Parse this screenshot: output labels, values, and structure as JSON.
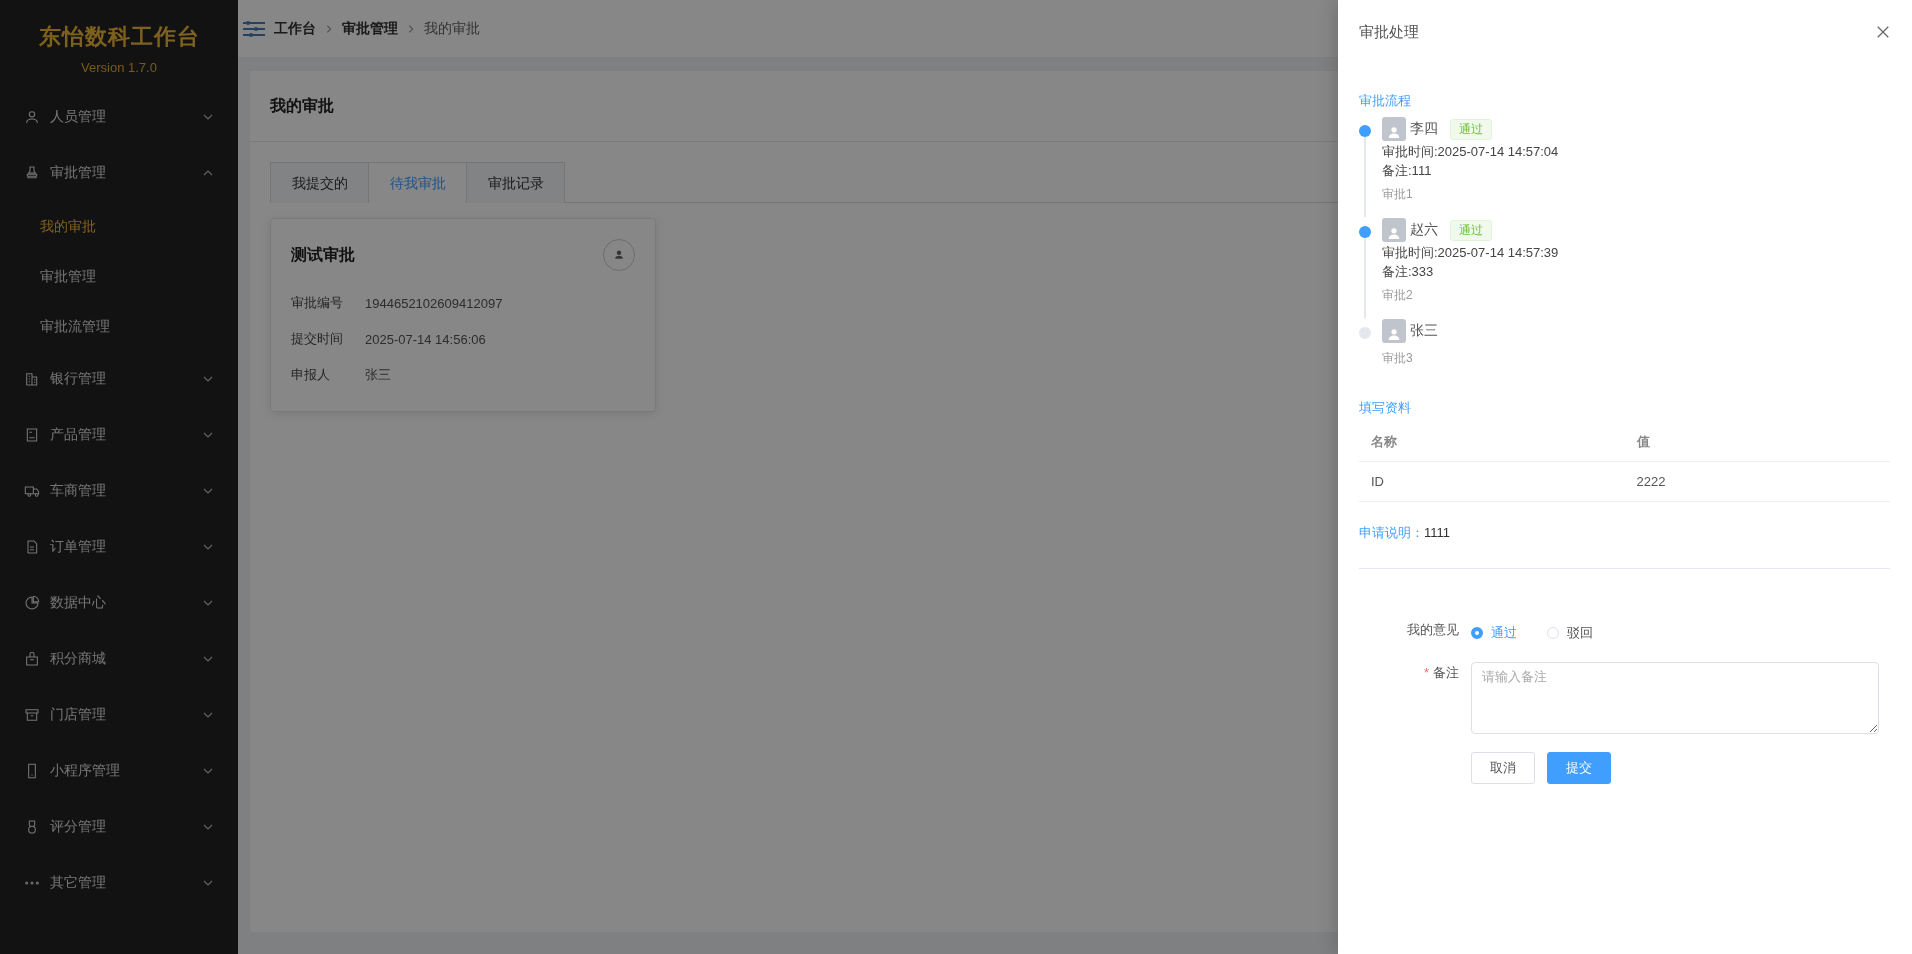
{
  "sidebar": {
    "title": "东怡数科工作台",
    "version": "Version 1.7.0",
    "items": [
      {
        "label": "人员管理",
        "expanded": false
      },
      {
        "label": "审批管理",
        "expanded": true,
        "children": [
          {
            "label": "我的审批",
            "selected": true
          },
          {
            "label": "审批管理",
            "selected": false
          },
          {
            "label": "审批流管理",
            "selected": false
          }
        ]
      },
      {
        "label": "银行管理",
        "expanded": false
      },
      {
        "label": "产品管理",
        "expanded": false
      },
      {
        "label": "车商管理",
        "expanded": false
      },
      {
        "label": "订单管理",
        "expanded": false
      },
      {
        "label": "数据中心",
        "expanded": false
      },
      {
        "label": "积分商城",
        "expanded": false
      },
      {
        "label": "门店管理",
        "expanded": false
      },
      {
        "label": "小程序管理",
        "expanded": false
      },
      {
        "label": "评分管理",
        "expanded": false
      },
      {
        "label": "其它管理",
        "expanded": false
      }
    ]
  },
  "breadcrumb": [
    "工作台",
    "审批管理",
    "我的审批"
  ],
  "page": {
    "title": "我的审批",
    "tabs": [
      {
        "label": "我提交的",
        "selected": false
      },
      {
        "label": "待我审批",
        "selected": true
      },
      {
        "label": "审批记录",
        "selected": false
      }
    ],
    "cards": [
      {
        "title": "测试审批",
        "fields": [
          {
            "label": "审批编号",
            "value": "1944652102609412097"
          },
          {
            "label": "提交时间",
            "value": "2025-07-14 14:56:06"
          },
          {
            "label": "申报人",
            "value": "张三"
          }
        ]
      }
    ]
  },
  "drawer": {
    "title": "审批处理",
    "flow_heading": "审批流程",
    "flow": [
      {
        "name": "李四",
        "done": true,
        "status": "通过",
        "time": "审批时间:2025-07-14 14:57:04",
        "note": "备注:111",
        "step": "审批1"
      },
      {
        "name": "赵六",
        "done": true,
        "status": "通过",
        "time": "审批时间:2025-07-14 14:57:39",
        "note": "备注:333",
        "step": "审批2"
      },
      {
        "name": "张三",
        "done": false,
        "step": "审批3"
      }
    ],
    "data_heading": "填写资料",
    "data_table": {
      "columns": [
        "名称",
        "值"
      ],
      "rows": [
        [
          "ID",
          "2222"
        ]
      ]
    },
    "note_label": "申请说明：",
    "note_value": "1111",
    "form": {
      "opinion_label": "我的意见",
      "options": [
        {
          "label": "通过",
          "selected": true
        },
        {
          "label": "驳回",
          "selected": false
        }
      ],
      "remark_label": "备注",
      "required_mark": "*",
      "remark_placeholder": "请输入备注",
      "buttons": [
        {
          "label": "取消",
          "kind": "default"
        },
        {
          "label": "提交",
          "kind": "primary"
        }
      ]
    }
  }
}
